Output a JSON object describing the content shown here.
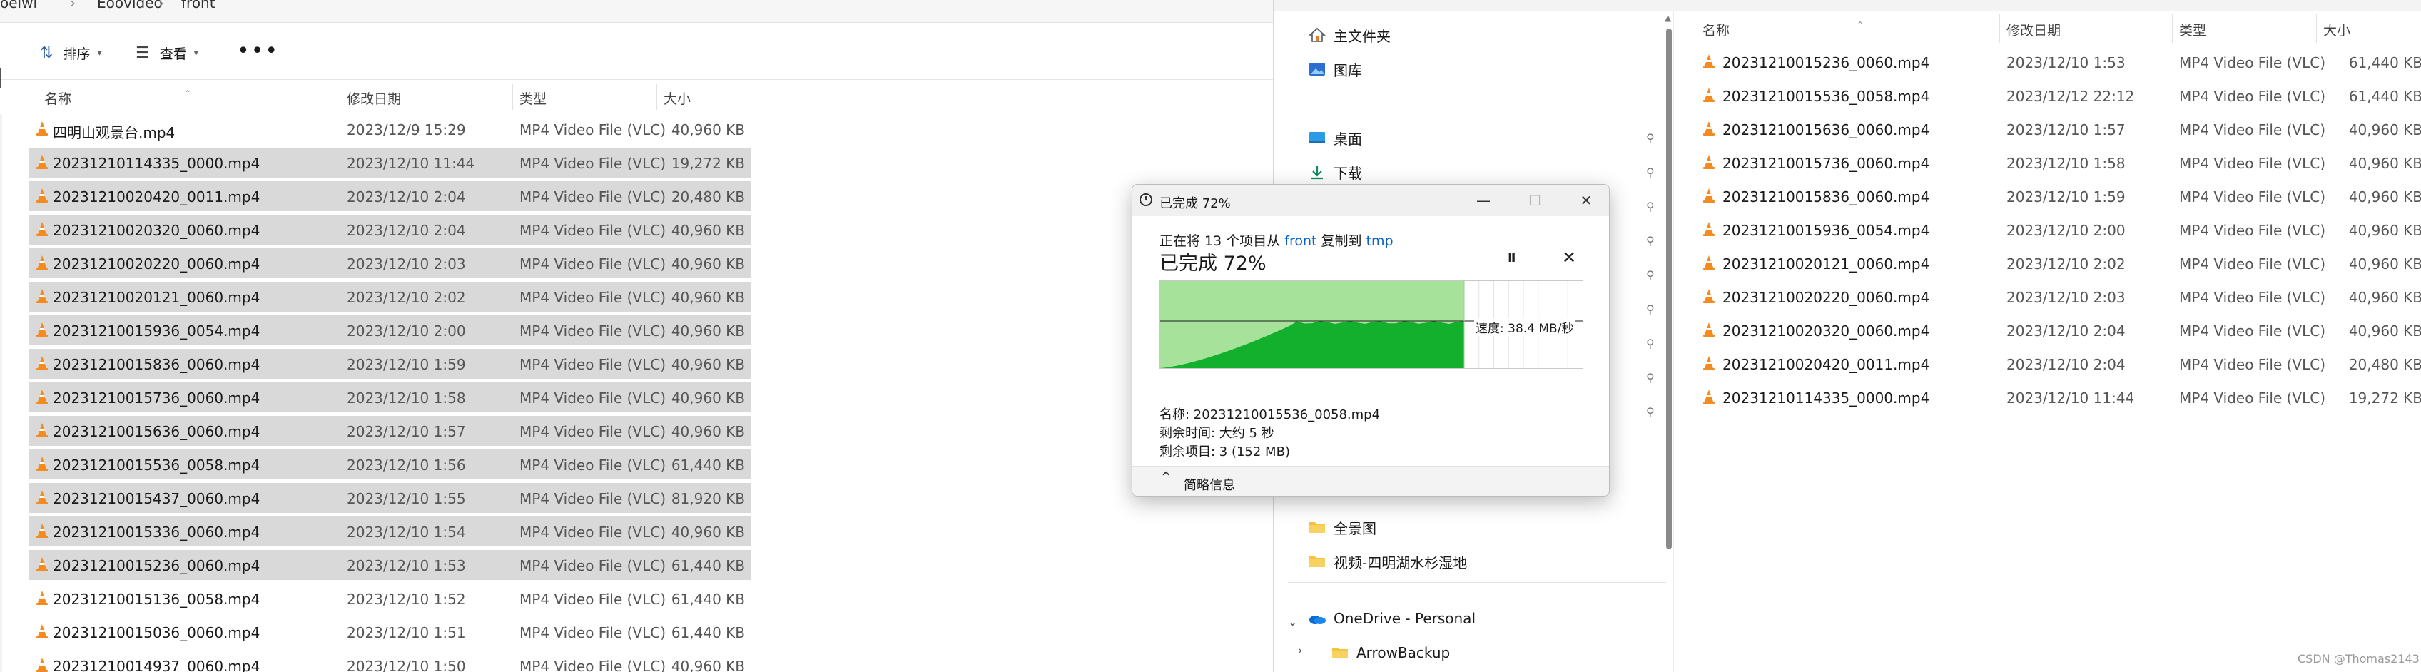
{
  "left": {
    "breadcrumb": [
      "oeiwi",
      "Eoovideo",
      "front"
    ],
    "toolbar": {
      "sort_label": "排序",
      "view_label": "查看",
      "more_label": "•••"
    },
    "columns": {
      "name": "名称",
      "date": "修改日期",
      "type": "类型",
      "size": "大小"
    },
    "rows": [
      {
        "name": "四明山观景台.mp4",
        "date": "2023/12/9 15:29",
        "type": "MP4 Video File (VLC)",
        "size": "40,960 KB",
        "selected": false
      },
      {
        "name": "20231210114335_0000.mp4",
        "date": "2023/12/10 11:44",
        "type": "MP4 Video File (VLC)",
        "size": "19,272 KB",
        "selected": true
      },
      {
        "name": "20231210020420_0011.mp4",
        "date": "2023/12/10 2:04",
        "type": "MP4 Video File (VLC)",
        "size": "20,480 KB",
        "selected": true
      },
      {
        "name": "20231210020320_0060.mp4",
        "date": "2023/12/10 2:04",
        "type": "MP4 Video File (VLC)",
        "size": "40,960 KB",
        "selected": true
      },
      {
        "name": "20231210020220_0060.mp4",
        "date": "2023/12/10 2:03",
        "type": "MP4 Video File (VLC)",
        "size": "40,960 KB",
        "selected": true
      },
      {
        "name": "20231210020121_0060.mp4",
        "date": "2023/12/10 2:02",
        "type": "MP4 Video File (VLC)",
        "size": "40,960 KB",
        "selected": true
      },
      {
        "name": "20231210015936_0054.mp4",
        "date": "2023/12/10 2:00",
        "type": "MP4 Video File (VLC)",
        "size": "40,960 KB",
        "selected": true
      },
      {
        "name": "20231210015836_0060.mp4",
        "date": "2023/12/10 1:59",
        "type": "MP4 Video File (VLC)",
        "size": "40,960 KB",
        "selected": true
      },
      {
        "name": "20231210015736_0060.mp4",
        "date": "2023/12/10 1:58",
        "type": "MP4 Video File (VLC)",
        "size": "40,960 KB",
        "selected": true
      },
      {
        "name": "20231210015636_0060.mp4",
        "date": "2023/12/10 1:57",
        "type": "MP4 Video File (VLC)",
        "size": "40,960 KB",
        "selected": true
      },
      {
        "name": "20231210015536_0058.mp4",
        "date": "2023/12/10 1:56",
        "type": "MP4 Video File (VLC)",
        "size": "61,440 KB",
        "selected": true
      },
      {
        "name": "20231210015437_0060.mp4",
        "date": "2023/12/10 1:55",
        "type": "MP4 Video File (VLC)",
        "size": "81,920 KB",
        "selected": true
      },
      {
        "name": "20231210015336_0060.mp4",
        "date": "2023/12/10 1:54",
        "type": "MP4 Video File (VLC)",
        "size": "40,960 KB",
        "selected": true
      },
      {
        "name": "20231210015236_0060.mp4",
        "date": "2023/12/10 1:53",
        "type": "MP4 Video File (VLC)",
        "size": "61,440 KB",
        "selected": true
      },
      {
        "name": "20231210015136_0058.mp4",
        "date": "2023/12/10 1:52",
        "type": "MP4 Video File (VLC)",
        "size": "61,440 KB",
        "selected": false
      },
      {
        "name": "20231210015036_0060.mp4",
        "date": "2023/12/10 1:51",
        "type": "MP4 Video File (VLC)",
        "size": "61,440 KB",
        "selected": false
      },
      {
        "name": "20231210014937_0060.mp4",
        "date": "2023/12/10 1:50",
        "type": "MP4 Video File (VLC)",
        "size": "40,960 KB",
        "selected": false
      }
    ]
  },
  "right": {
    "nav": {
      "home": "主文件夹",
      "pictures": "图库",
      "desktop": "桌面",
      "downloads": "下载",
      "panorama": "全景图",
      "video_folder": "视频-四明湖水杉湿地",
      "onedrive": "OneDrive - Personal",
      "arrowbackup": "ArrowBackup"
    },
    "columns": {
      "name": "名称",
      "date": "修改日期",
      "type": "类型",
      "size": "大小"
    },
    "rows": [
      {
        "name": "20231210015236_0060.mp4",
        "date": "2023/12/10 1:53",
        "type": "MP4 Video File (VLC)",
        "size": "61,440 KB"
      },
      {
        "name": "20231210015536_0058.mp4",
        "date": "2023/12/12 22:12",
        "type": "MP4 Video File (VLC)",
        "size": "61,440 KB"
      },
      {
        "name": "20231210015636_0060.mp4",
        "date": "2023/12/10 1:57",
        "type": "MP4 Video File (VLC)",
        "size": "40,960 KB"
      },
      {
        "name": "20231210015736_0060.mp4",
        "date": "2023/12/10 1:58",
        "type": "MP4 Video File (VLC)",
        "size": "40,960 KB"
      },
      {
        "name": "20231210015836_0060.mp4",
        "date": "2023/12/10 1:59",
        "type": "MP4 Video File (VLC)",
        "size": "40,960 KB"
      },
      {
        "name": "20231210015936_0054.mp4",
        "date": "2023/12/10 2:00",
        "type": "MP4 Video File (VLC)",
        "size": "40,960 KB"
      },
      {
        "name": "20231210020121_0060.mp4",
        "date": "2023/12/10 2:02",
        "type": "MP4 Video File (VLC)",
        "size": "40,960 KB"
      },
      {
        "name": "20231210020220_0060.mp4",
        "date": "2023/12/10 2:03",
        "type": "MP4 Video File (VLC)",
        "size": "40,960 KB"
      },
      {
        "name": "20231210020320_0060.mp4",
        "date": "2023/12/10 2:04",
        "type": "MP4 Video File (VLC)",
        "size": "40,960 KB"
      },
      {
        "name": "20231210020420_0011.mp4",
        "date": "2023/12/10 2:04",
        "type": "MP4 Video File (VLC)",
        "size": "20,480 KB"
      },
      {
        "name": "20231210114335_0000.mp4",
        "date": "2023/12/10 11:44",
        "type": "MP4 Video File (VLC)",
        "size": "19,272 KB"
      }
    ]
  },
  "dialog": {
    "title": "已完成 72%",
    "desc_prefix": "正在将 13 个项目从 ",
    "source": "front",
    "desc_mid": " 复制到 ",
    "dest": "tmp",
    "percent_label": "已完成 72%",
    "progress": 0.72,
    "speed_label": "速度: 38.4 MB/秒",
    "name_line": "名称: 20231210015536_0058.mp4",
    "time_line": "剩余时间: 大约 5 秒",
    "items_line": "剩余项目: 3 (152 MB)",
    "less_details": "简略信息",
    "minimize_glyph": "—",
    "maximize_glyph": "☐",
    "close_glyph": "✕",
    "pause_glyph": "II",
    "stop_glyph": "✕"
  },
  "watermark": "CSDN @Thomas2143",
  "colors": {
    "progress_fill": "#a6e29a",
    "speed_fill": "#12b02c",
    "link": "#0b63c5",
    "selected_row": "#d9d9d9"
  },
  "icons": {
    "file": "vlc-cone-icon",
    "folder": "folder-icon"
  }
}
